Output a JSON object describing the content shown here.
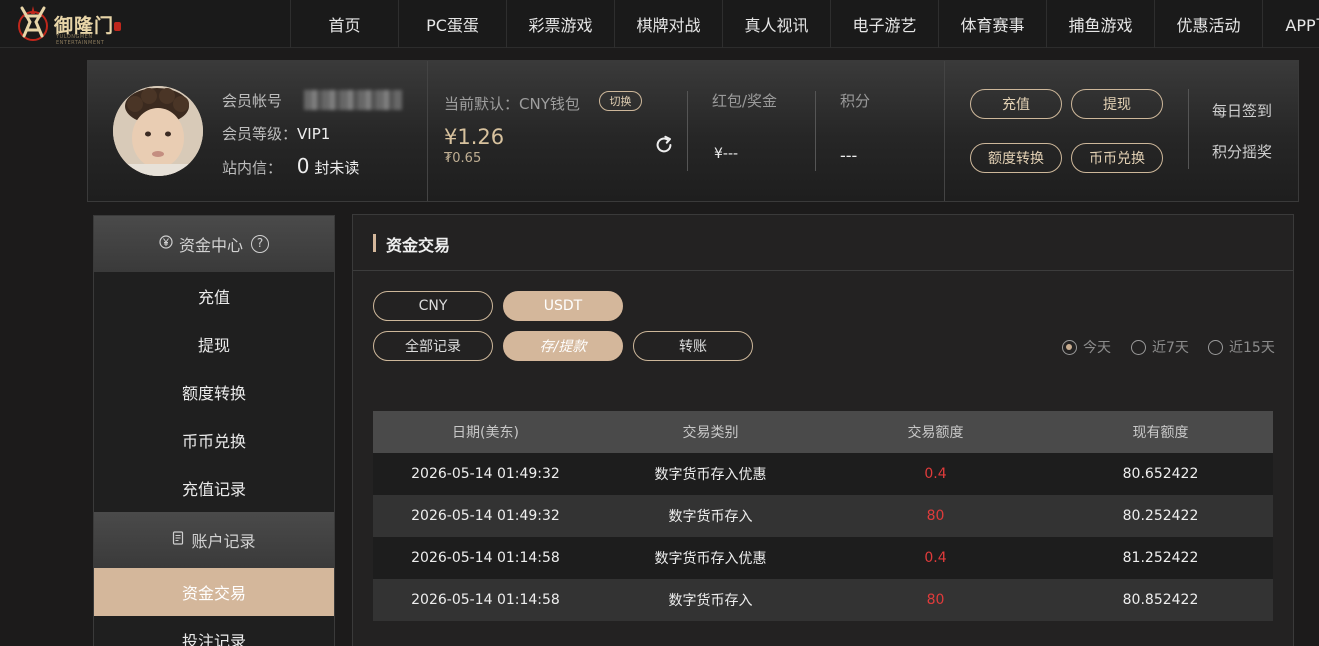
{
  "brand": {
    "name": "御隆门",
    "tagline": "YULONGMEN ENTERTAINMENT"
  },
  "nav": [
    "首页",
    "PC蛋蛋",
    "彩票游戏",
    "棋牌对战",
    "真人视讯",
    "电子游艺",
    "体育赛事",
    "捕鱼游戏",
    "优惠活动",
    "APP下载"
  ],
  "user": {
    "account_label": "会员帐号",
    "level_label": "会员等级：",
    "level_value": "VIP1",
    "msg_label": "站内信：",
    "msg_count": "0",
    "msg_suffix": "封未读"
  },
  "wallet": {
    "default_label": "当前默认：CNY钱包",
    "switch_label": "切换",
    "balance": "¥1.26",
    "sub_balance": "₮0.65"
  },
  "stats": [
    {
      "label": "红包/奖金",
      "value": "¥---"
    },
    {
      "label": "积分",
      "value": "---"
    }
  ],
  "actions": [
    "充值",
    "提现",
    "额度转换",
    "币币兑换"
  ],
  "side_links": [
    "每日签到",
    "积分摇奖"
  ],
  "sidebar": {
    "group1_title": "资金中心",
    "group1_items": [
      "充值",
      "提现",
      "额度转换",
      "币币兑换",
      "充值记录"
    ],
    "group2_title": "账户记录",
    "group2_items": [
      "资金交易",
      "投注记录"
    ]
  },
  "content": {
    "title": "资金交易",
    "currency_tabs": [
      "CNY",
      "USDT"
    ],
    "type_tabs": [
      "全部记录",
      "存/提款",
      "转账"
    ],
    "ranges": [
      "今天",
      "近7天",
      "近15天"
    ],
    "table": {
      "headers": [
        "日期(美东)",
        "交易类别",
        "交易额度",
        "现有额度"
      ],
      "rows": [
        [
          "2026-05-14 01:49:32",
          "数字货币存入优惠",
          "0.4",
          "80.652422"
        ],
        [
          "2026-05-14 01:49:32",
          "数字货币存入",
          "80",
          "80.252422"
        ],
        [
          "2026-05-14 01:14:58",
          "数字货币存入优惠",
          "0.4",
          "81.252422"
        ],
        [
          "2026-05-14 01:14:58",
          "数字货币存入",
          "80",
          "80.852422"
        ]
      ]
    }
  }
}
